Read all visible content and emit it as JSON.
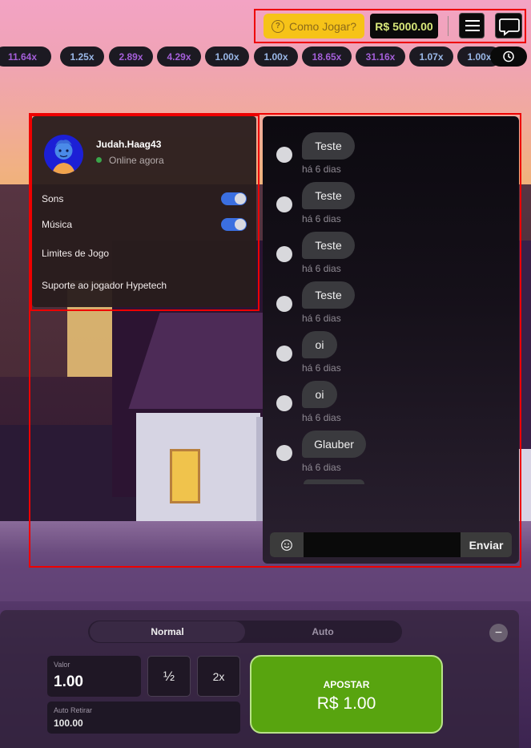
{
  "header": {
    "help_label": "Como Jogar?",
    "balance": "R$ 5000.00"
  },
  "multipliers": [
    {
      "value": "11.64x",
      "tone": "purple"
    },
    {
      "value": "1.25x",
      "tone": "blue"
    },
    {
      "value": "2.89x",
      "tone": "purple"
    },
    {
      "value": "4.29x",
      "tone": "purple"
    },
    {
      "value": "1.00x",
      "tone": "blue"
    },
    {
      "value": "1.00x",
      "tone": "blue"
    },
    {
      "value": "18.65x",
      "tone": "purple"
    },
    {
      "value": "31.16x",
      "tone": "purple"
    },
    {
      "value": "1.07x",
      "tone": "blue"
    },
    {
      "value": "1.00x",
      "tone": "blue"
    }
  ],
  "profile": {
    "username": "Judah.Haag43",
    "status": "Online agora",
    "settings": [
      {
        "label": "Sons",
        "toggle": true
      },
      {
        "label": "Música",
        "toggle": true
      },
      {
        "label": "Limites de Jogo",
        "toggle": null
      },
      {
        "label": "Suporte ao jogador Hypetech",
        "toggle": null
      }
    ]
  },
  "chat": {
    "messages": [
      {
        "text": "Teste",
        "time": "há 6 dias"
      },
      {
        "text": "Teste",
        "time": "há 6 dias"
      },
      {
        "text": "Teste",
        "time": "há 6 dias"
      },
      {
        "text": "Teste",
        "time": "há 6 dias"
      },
      {
        "text": "oi",
        "time": "há 6 dias"
      },
      {
        "text": "oi",
        "time": "há 6 dias"
      },
      {
        "text": "Glauber",
        "time": "há 6 dias"
      }
    ],
    "input_value": "",
    "send_label": "Enviar"
  },
  "bet": {
    "tabs": [
      "Normal",
      "Auto"
    ],
    "active_tab": "Normal",
    "value_label": "Valor",
    "value": "1.00",
    "half_label": "½",
    "double_label": "2x",
    "auto_withdraw_label": "Auto Retirar",
    "auto_withdraw_value": "100.00",
    "bet_label": "APOSTAR",
    "bet_amount": "R$ 1.00"
  },
  "colors": {
    "accent_yellow": "#f6c318",
    "balance_text": "#d8e87a",
    "bet_green": "#58a40f",
    "toggle_blue": "#3b6fe0",
    "multiplier_purple": "#a45fd9",
    "multiplier_blue": "#9ab8e8",
    "annotation_red": "#ee0000"
  }
}
